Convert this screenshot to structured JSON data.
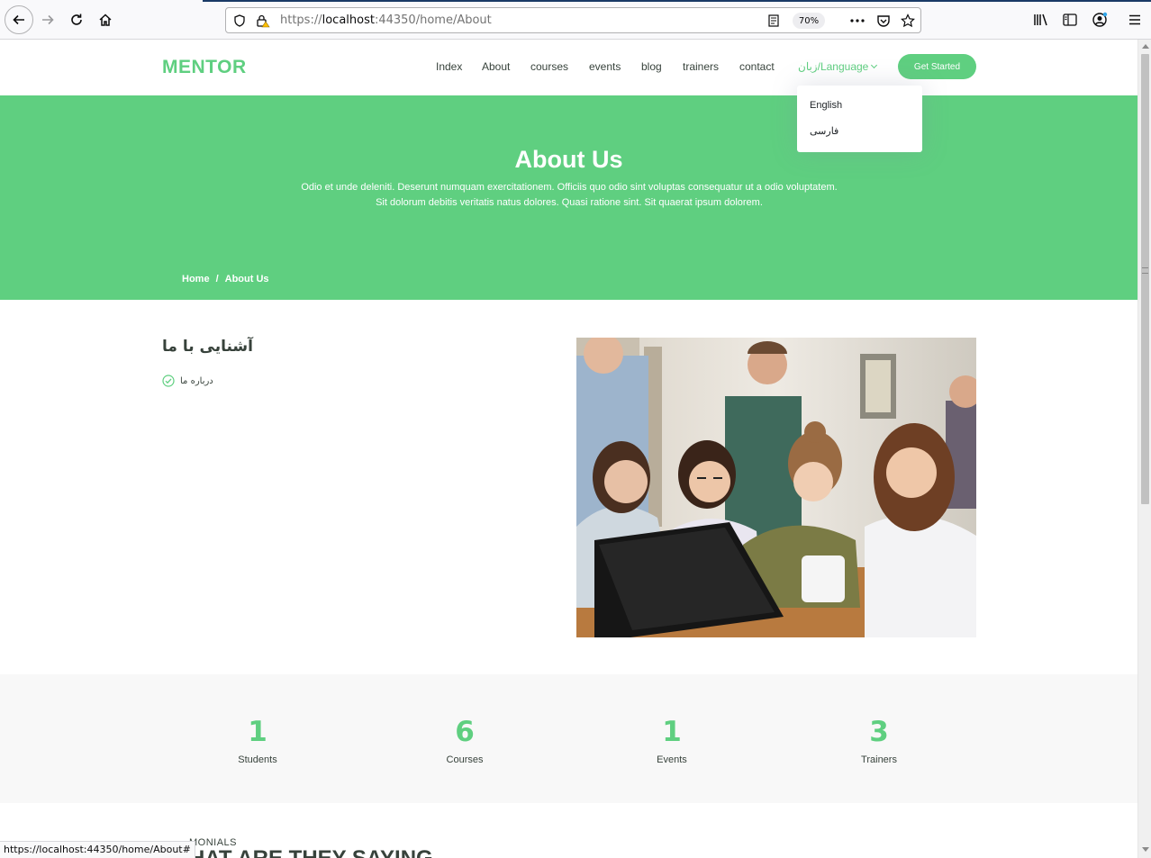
{
  "browser": {
    "url_prefix": "https://",
    "url_host": "localhost",
    "url_rest": ":44350/home/About",
    "zoom": "70%",
    "status_url": "https://localhost:44350/home/About#"
  },
  "site": {
    "logo": "MENTOR",
    "nav": [
      "Index",
      "About",
      "courses",
      "events",
      "blog",
      "trainers",
      "contact"
    ],
    "language_label": "زبان/Language",
    "cta": "Get Started",
    "language_options": [
      "English",
      "فارسی"
    ]
  },
  "hero": {
    "title": "About Us",
    "subtitle": "Odio et unde deleniti. Deserunt numquam exercitationem. Officiis quo odio sint voluptas consequatur ut a odio voluptatem. Sit dolorum debitis veritatis natus dolores. Quasi ratione sint. Sit quaerat ipsum dolorem.",
    "breadcrumb_home": "Home",
    "breadcrumb_sep": "/",
    "breadcrumb_current": "About Us"
  },
  "about": {
    "title": "آشنایی با ما",
    "item": "درباره ما"
  },
  "counts": [
    {
      "num": "1",
      "label": "Students"
    },
    {
      "num": "6",
      "label": "Courses"
    },
    {
      "num": "1",
      "label": "Events"
    },
    {
      "num": "3",
      "label": "Trainers"
    }
  ],
  "testimonials": {
    "label": "MONIALS",
    "heading": "HAT ARE THEY SAYING"
  },
  "colors": {
    "accent": "#5fcf80",
    "text": "#37423b",
    "counts_bg": "#f8f8f8"
  }
}
